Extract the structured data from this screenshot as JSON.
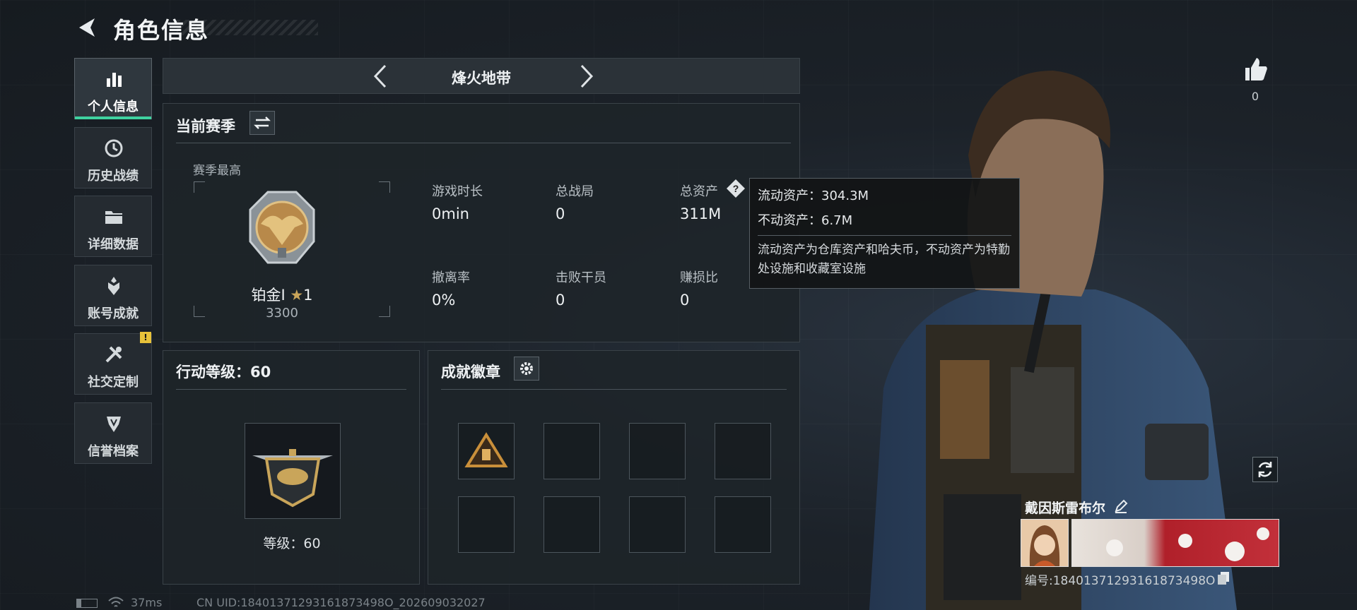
{
  "header": {
    "title": "角色信息"
  },
  "sidebar": {
    "items": [
      {
        "label": "个人信息",
        "icon": "bar-chart-icon"
      },
      {
        "label": "历史战绩",
        "icon": "history-clock-icon"
      },
      {
        "label": "详细数据",
        "icon": "folder-icon"
      },
      {
        "label": "账号成就",
        "icon": "achievement-icon"
      },
      {
        "label": "社交定制",
        "icon": "tools-icon"
      },
      {
        "label": "信誉档案",
        "icon": "shield-badge-icon"
      }
    ],
    "alert": "!"
  },
  "mode": {
    "name": "烽火地带"
  },
  "season": {
    "title": "当前赛季",
    "best_label": "赛季最高",
    "rank_name": "铂金Ⅰ",
    "rank_stars": "1",
    "rank_points": "3300",
    "stats": [
      {
        "label": "游戏时长",
        "value": "0min"
      },
      {
        "label": "总战局",
        "value": "0"
      },
      {
        "label": "总资产",
        "value": "311M"
      },
      {
        "label": "撤离率",
        "value": "0%"
      },
      {
        "label": "击败干员",
        "value": "0"
      },
      {
        "label": "赚损比",
        "value": "0"
      }
    ]
  },
  "tooltip": {
    "liquid": "流动资产：304.3M",
    "fixed": "不动资产：6.7M",
    "desc": "流动资产为仓库资产和哈夫币，不动资产为特勤处设施和收藏室设施"
  },
  "action": {
    "title": "行动等级：60",
    "level_text": "等级：60"
  },
  "badges": {
    "title": "成就徽章"
  },
  "likes": {
    "count": "0"
  },
  "character": {
    "name": "戴因斯雷布尔",
    "uid_label": "编号:18401371293161873498O"
  },
  "status": {
    "ping": "37ms",
    "uid": "CN UID:18401371293161873498O_202609032027"
  },
  "colors": {
    "accent": "#3fd2a0",
    "warn": "#e8c23a"
  }
}
